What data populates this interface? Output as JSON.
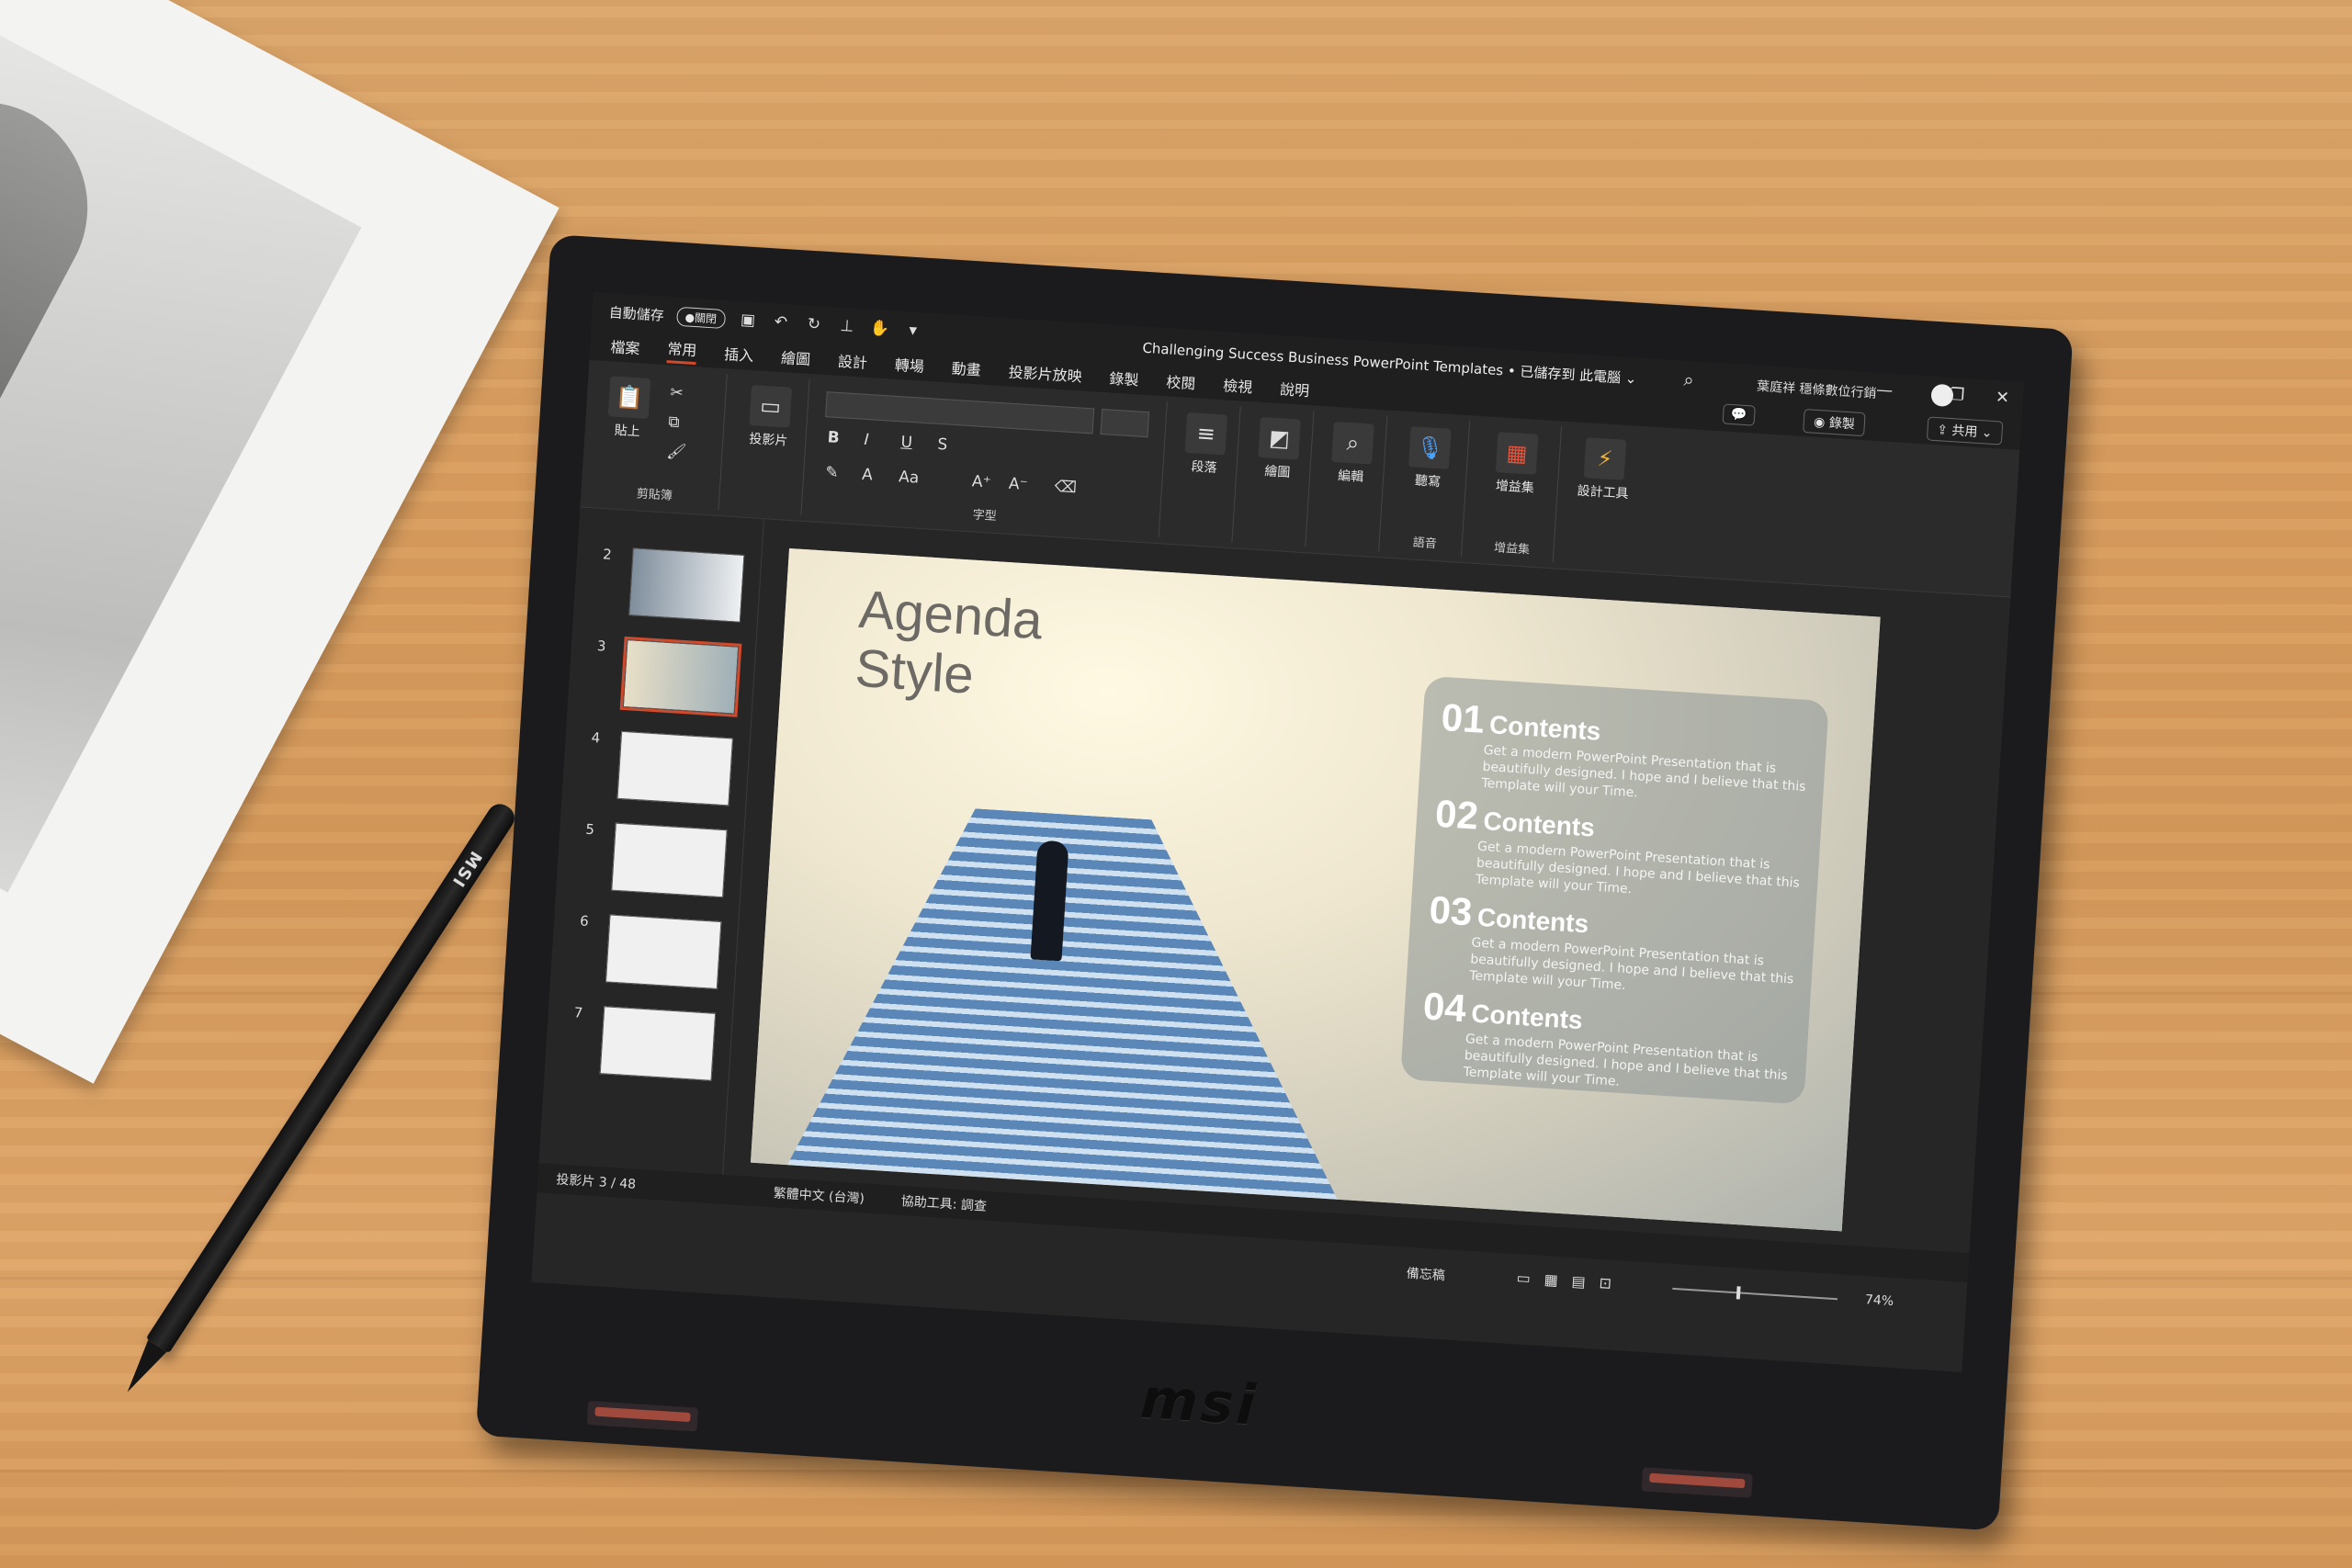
{
  "magazine": {},
  "stylus": {
    "brand": "MSI"
  },
  "laptop": {
    "logo": "msi"
  },
  "titlebar": {
    "autosave_label": "自動儲存",
    "autosave_toggle": "●關閉",
    "document_title": "Challenging Success Business PowerPoint Templates • 已儲存到 此電腦 ⌄",
    "user_name": "葉庭祥 穩條數位行銷"
  },
  "menu": {
    "tabs": [
      "檔案",
      "常用",
      "插入",
      "繪圖",
      "設計",
      "轉場",
      "動畫",
      "投影片放映",
      "錄製",
      "校閱",
      "檢視",
      "說明"
    ],
    "record": "◉ 錄製",
    "share": "⇪ 共用 ⌄"
  },
  "ribbon": {
    "clipboard": {
      "paste": "貼上",
      "label": "剪貼簿"
    },
    "slides": {
      "label": "投影片"
    },
    "font": {
      "label": "字型",
      "bold": "B",
      "italic": "I",
      "underline": "U",
      "strike": "S"
    },
    "paragraph": {
      "label": "段落"
    },
    "drawing": {
      "label": "繪圖"
    },
    "editing": {
      "label": "編輯"
    },
    "voice": {
      "dictate": "聽寫",
      "label": "語音"
    },
    "addins": {
      "button": "增益集",
      "label": "增益集"
    },
    "designer": {
      "button": "設計工具"
    }
  },
  "thumbnails": {
    "numbers": [
      "2",
      "3",
      "4",
      "5",
      "6",
      "7"
    ],
    "selected": "3"
  },
  "slide": {
    "title_line1": "Agenda",
    "title_line2": "Style",
    "items": [
      {
        "num": "01",
        "head": "Contents",
        "desc": "Get a modern PowerPoint Presentation that is beautifully designed. I hope and I believe that this Template will your Time."
      },
      {
        "num": "02",
        "head": "Contents",
        "desc": "Get a modern PowerPoint Presentation that is beautifully designed. I hope and I believe that this Template will your Time."
      },
      {
        "num": "03",
        "head": "Contents",
        "desc": "Get a modern PowerPoint Presentation that is beautifully designed. I hope and I believe that this Template will your Time."
      },
      {
        "num": "04",
        "head": "Contents",
        "desc": "Get a modern PowerPoint Presentation that is beautifully designed. I hope and I believe that this Template will your Time."
      }
    ]
  },
  "status": {
    "slide_count": "投影片 3 / 48",
    "language": "繁體中文 (台灣)",
    "accessibility": "協助工具: 調查",
    "notes": "備忘稿",
    "zoom": "74%"
  },
  "colors": {
    "accent": "#d04a2d",
    "wood": "#d99d5f"
  }
}
